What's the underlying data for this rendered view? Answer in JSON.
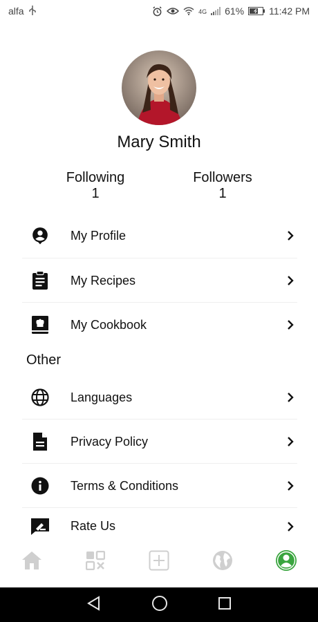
{
  "status_bar": {
    "carrier": "alfa",
    "network": "4G",
    "battery": "61%",
    "time": "11:42 PM"
  },
  "profile": {
    "name": "Mary Smith",
    "following_label": "Following",
    "following_count": "1",
    "followers_label": "Followers",
    "followers_count": "1"
  },
  "menu": {
    "items": [
      {
        "label": "My Profile",
        "icon": "user-pin-icon"
      },
      {
        "label": "My Recipes",
        "icon": "clipboard-icon"
      },
      {
        "label": "My Cookbook",
        "icon": "cookbook-icon"
      }
    ]
  },
  "other": {
    "title": "Other",
    "items": [
      {
        "label": "Languages",
        "icon": "globe-icon"
      },
      {
        "label": "Privacy Policy",
        "icon": "document-icon"
      },
      {
        "label": "Terms & Conditions",
        "icon": "info-icon"
      },
      {
        "label": "Rate Us",
        "icon": "rate-icon"
      }
    ]
  },
  "bottom_nav": {
    "items": [
      "home-icon",
      "qr-scan-icon",
      "add-icon",
      "world-icon",
      "profile-icon"
    ],
    "active_color": "#3aa53f",
    "inactive_color": "#c8c8c8"
  }
}
